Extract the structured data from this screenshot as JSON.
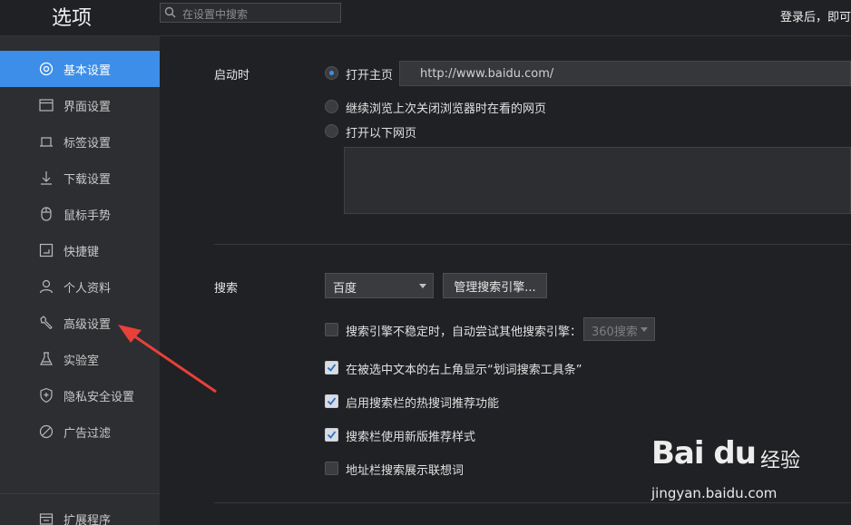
{
  "header": {
    "title": "选项",
    "search_placeholder": "在设置中搜索",
    "login_hint": "登录后，即可"
  },
  "sidebar": {
    "items": [
      {
        "label": "基本设置",
        "icon": "gear-icon"
      },
      {
        "label": "界面设置",
        "icon": "window-icon"
      },
      {
        "label": "标签设置",
        "icon": "tab-icon"
      },
      {
        "label": "下载设置",
        "icon": "download-icon"
      },
      {
        "label": "鼠标手势",
        "icon": "mouse-icon"
      },
      {
        "label": "快捷键",
        "icon": "shortcut-icon"
      },
      {
        "label": "个人资料",
        "icon": "person-icon"
      },
      {
        "label": "高级设置",
        "icon": "wrench-icon"
      },
      {
        "label": "实验室",
        "icon": "flask-icon"
      },
      {
        "label": "隐私安全设置",
        "icon": "shield-icon"
      },
      {
        "label": "广告过滤",
        "icon": "block-icon"
      }
    ],
    "footer_item": {
      "label": "扩展程序",
      "icon": "extension-icon"
    },
    "active_index": 0
  },
  "startup": {
    "section_label": "启动时",
    "options": [
      {
        "label": "打开主页",
        "selected": true
      },
      {
        "label": "继续浏览上次关闭浏览器时在看的网页",
        "selected": false
      },
      {
        "label": "打开以下网页",
        "selected": false
      }
    ],
    "homepage_url": "http://www.baidu.com/"
  },
  "search": {
    "section_label": "搜索",
    "engine_value": "百度",
    "manage_button": "管理搜索引擎...",
    "options": [
      {
        "label": "搜索引擎不稳定时，自动尝试其他搜索引擎：",
        "checked": false
      },
      {
        "label": "在被选中文本的右上角显示“划词搜索工具条”",
        "checked": true
      },
      {
        "label": "启用搜索栏的热搜词推荐功能",
        "checked": true
      },
      {
        "label": "搜索栏使用新版推荐样式",
        "checked": true
      },
      {
        "label": "地址栏搜索展示联想词",
        "checked": false
      }
    ],
    "fallback_engine_value": "360搜索"
  },
  "watermark": {
    "brand": "Bai du",
    "product": "经验",
    "url": "jingyan.baidu.com"
  },
  "colors": {
    "accent": "#3d8ee8",
    "annotation_arrow": "#e8403a"
  }
}
